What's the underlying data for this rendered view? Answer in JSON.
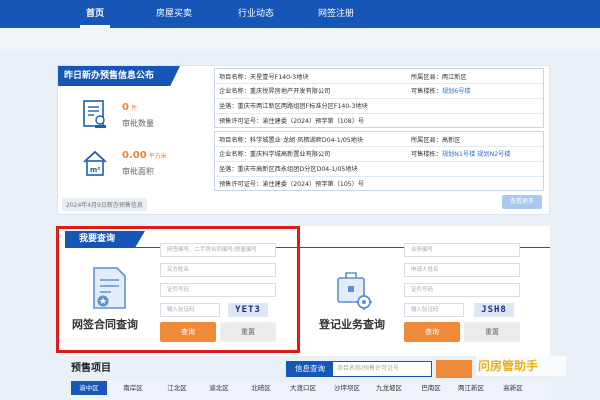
{
  "nav": {
    "items": [
      {
        "label": "首页",
        "active": true
      },
      {
        "label": "房屋买卖",
        "active": false
      },
      {
        "label": "行业动态",
        "active": false
      },
      {
        "label": "网签注册",
        "active": false
      }
    ]
  },
  "presale": {
    "title": "昨日新办预售信息公布",
    "approved_count": {
      "value": "0",
      "unit": "件",
      "label": "审批数量"
    },
    "approved_area": {
      "value": "0.00",
      "unit": "平方米",
      "label": "审批面积"
    },
    "date_note": "2024年4月9日新办预售信息",
    "more_label": "查看更多",
    "records": [
      {
        "project": "项目名称：天星壹号F140-3地块",
        "district": "所属区县：两江新区",
        "company": "企业名称：重庆悦昇房地产开发有限公司",
        "buildings_label": "可售楼栋：",
        "buildings": [
          "规划6号楼"
        ],
        "location": "坐落：重庆市两江新区两路组团F标准分区F140-3地块",
        "permit": "预售许可证号：渝住建委（2024）预字第（108）号"
      },
      {
        "project": "项目名称：科学城置业·龙胡·凤栖湖畔D04-1/05地块",
        "district": "所属区县：高新区",
        "company": "企业名称：重庆科学城高新置业有限公司",
        "buildings_label": "可售楼栋：",
        "buildings": [
          "规划N1号楼",
          "规划N2号楼"
        ],
        "location": "坐落：重庆市高新区西永组团D分区D04-1/05地块",
        "permit": "预售许可证号：渝住建委（2024）预字第（105）号"
      }
    ]
  },
  "query": {
    "title": "我要查询",
    "contract": {
      "title": "网签合同查询",
      "fields": [
        "网签编号、二手房合同编号/房屋编号",
        "买方姓名",
        "证件号码"
      ],
      "captcha_placeholder": "输入验证码",
      "captcha": "YET3",
      "query_label": "查询",
      "reset_label": "重置"
    },
    "registration": {
      "title": "登记业务查询",
      "fields": [
        "业务编号",
        "申请人姓名",
        "证件号码"
      ],
      "captcha_placeholder": "输入验证码",
      "captcha": "JSH8",
      "query_label": "查询",
      "reset_label": "重置"
    }
  },
  "presale_items": {
    "title": "预售项目",
    "info_query_label": "信息查询",
    "info_query_placeholder": "项目名称/预售许可证号",
    "watermark": "问房管助手",
    "districts": [
      {
        "label": "渝中区",
        "active": true
      },
      {
        "label": "南岸区",
        "active": false
      },
      {
        "label": "江北区",
        "active": false
      },
      {
        "label": "渝北区",
        "active": false
      },
      {
        "label": "北碚区",
        "active": false
      },
      {
        "label": "大渡口区",
        "active": false
      },
      {
        "label": "沙坪坝区",
        "active": false
      },
      {
        "label": "九龙坡区",
        "active": false
      },
      {
        "label": "巴南区",
        "active": false
      },
      {
        "label": "两江新区",
        "active": false
      },
      {
        "label": "高新区",
        "active": false
      }
    ]
  },
  "colors": {
    "brand_blue": "#1556b6",
    "accent_orange": "#f08a3b",
    "highlight_red": "#e01919"
  }
}
